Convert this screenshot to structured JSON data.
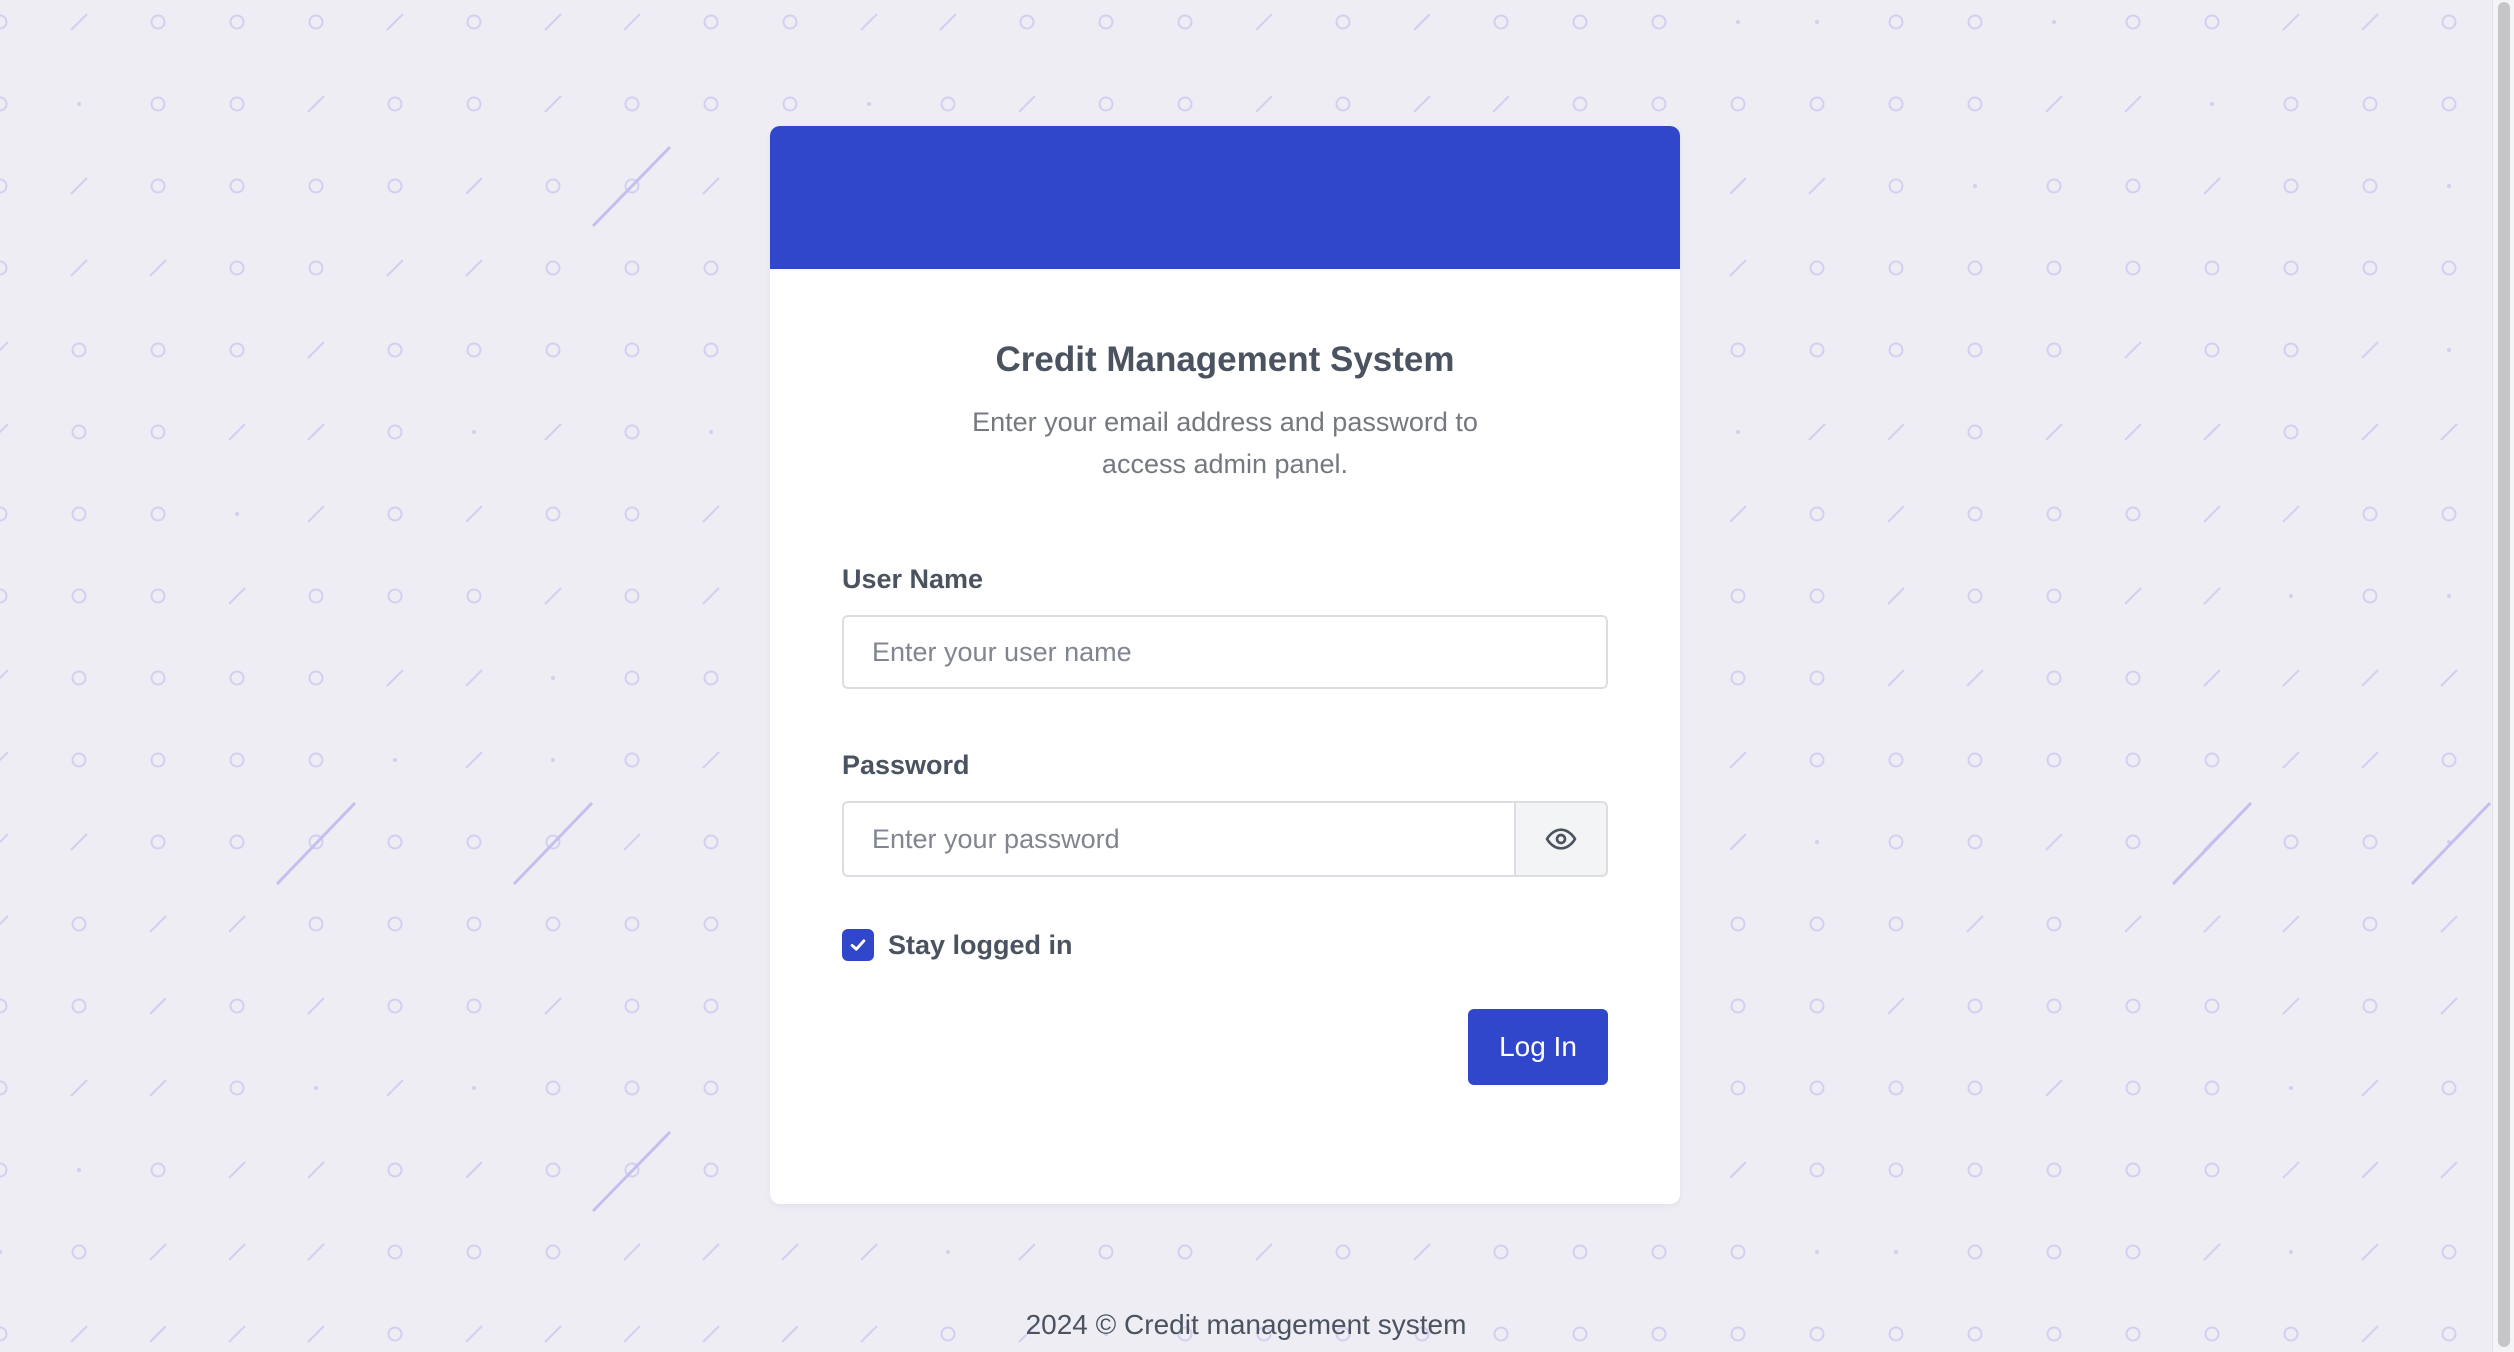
{
  "colors": {
    "accent": "#3047cc",
    "background": "#eeedf4",
    "pattern": "#d2cff0"
  },
  "card": {
    "title": "Credit Management System",
    "subtitle": "Enter your email address and password to access admin panel."
  },
  "form": {
    "username_label": "User Name",
    "username_placeholder": "Enter your user name",
    "password_label": "Password",
    "password_placeholder": "Enter your password",
    "password_toggle_icon": "eye-icon",
    "remember_label": "Stay logged in",
    "remember_checked": true,
    "submit_label": "Log In"
  },
  "footer": {
    "text": "2024 © Credit management system"
  }
}
